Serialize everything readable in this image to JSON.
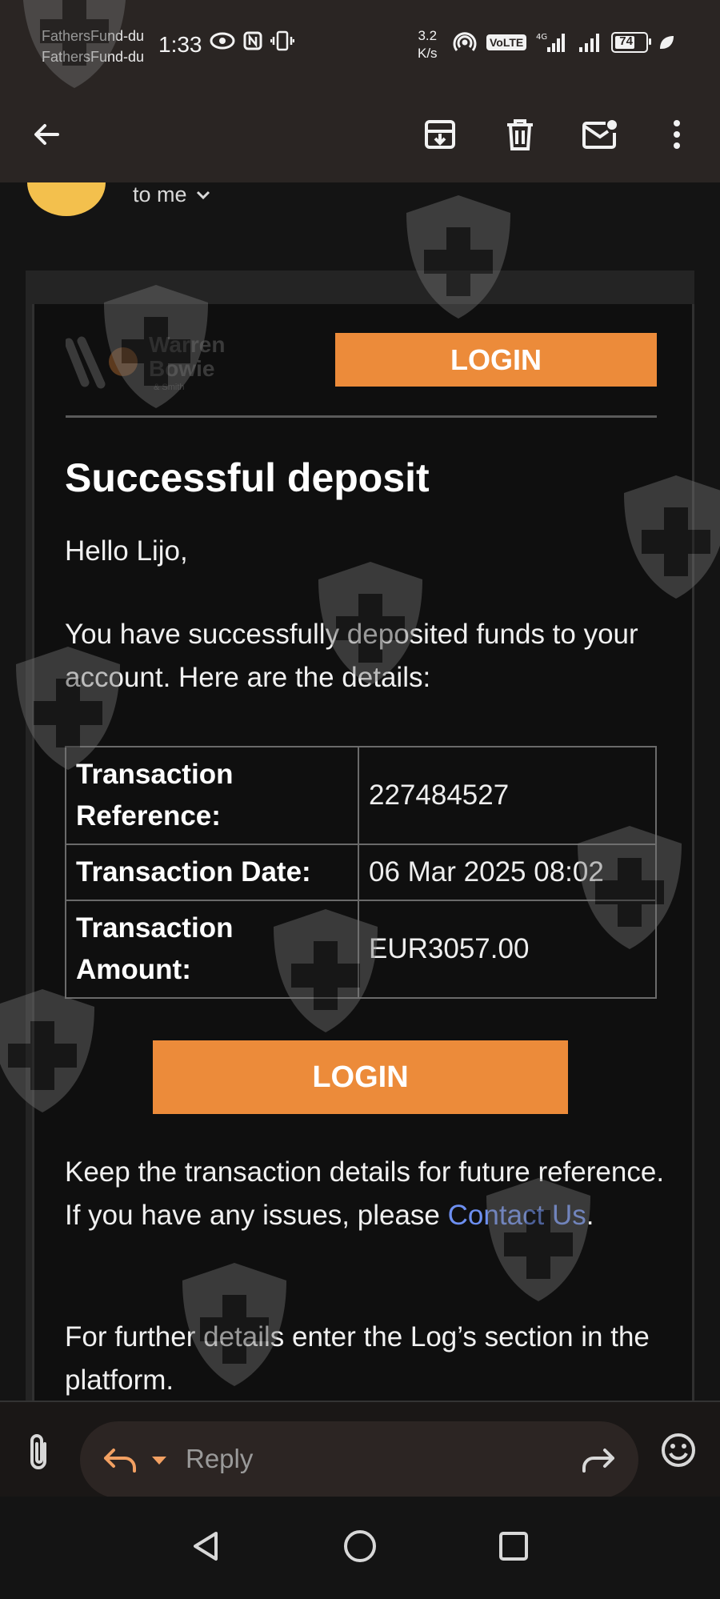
{
  "status_bar": {
    "notification_lines": [
      "FathersFund-du",
      "FathersFund-du"
    ],
    "time": "1:33",
    "net_speed_value": "3.2",
    "net_speed_unit": "K/s",
    "volte_label": "VoLTE",
    "battery_level": "74"
  },
  "app_bar": {
    "back_icon": "arrow-left-icon",
    "archive_icon": "archive-icon",
    "delete_icon": "trash-icon",
    "unread_icon": "mark-unread-icon",
    "more_icon": "more-vert-icon"
  },
  "message_header": {
    "recipient_label": "to me"
  },
  "email": {
    "logo_lines": [
      "Warren",
      "Bowie",
      "& Smith"
    ],
    "top_login_label": "LOGIN",
    "headline": "Successful deposit",
    "greeting": "Hello Lijo,",
    "intro": "You have successfully deposited funds to your account. Here are the details:",
    "details": [
      {
        "label": "Transaction Reference:",
        "value": "227484527"
      },
      {
        "label": "Transaction Date:",
        "value": "06 Mar 2025 08:02"
      },
      {
        "label": "Transaction Amount:",
        "value": "EUR3057.00"
      }
    ],
    "main_login_label": "LOGIN",
    "keep_text": "Keep the transaction details for future reference. If you have any issues, please",
    "contact_link": "Contact Us",
    "keep_text_end": ".",
    "further_text": "For further details enter the Log’s section in the platform."
  },
  "reply_bar": {
    "reply_label": "Reply"
  },
  "colors": {
    "accent_orange": "#ec8b3a",
    "link_blue": "#6d8ff0",
    "avatar_yellow": "#f3c04d"
  }
}
